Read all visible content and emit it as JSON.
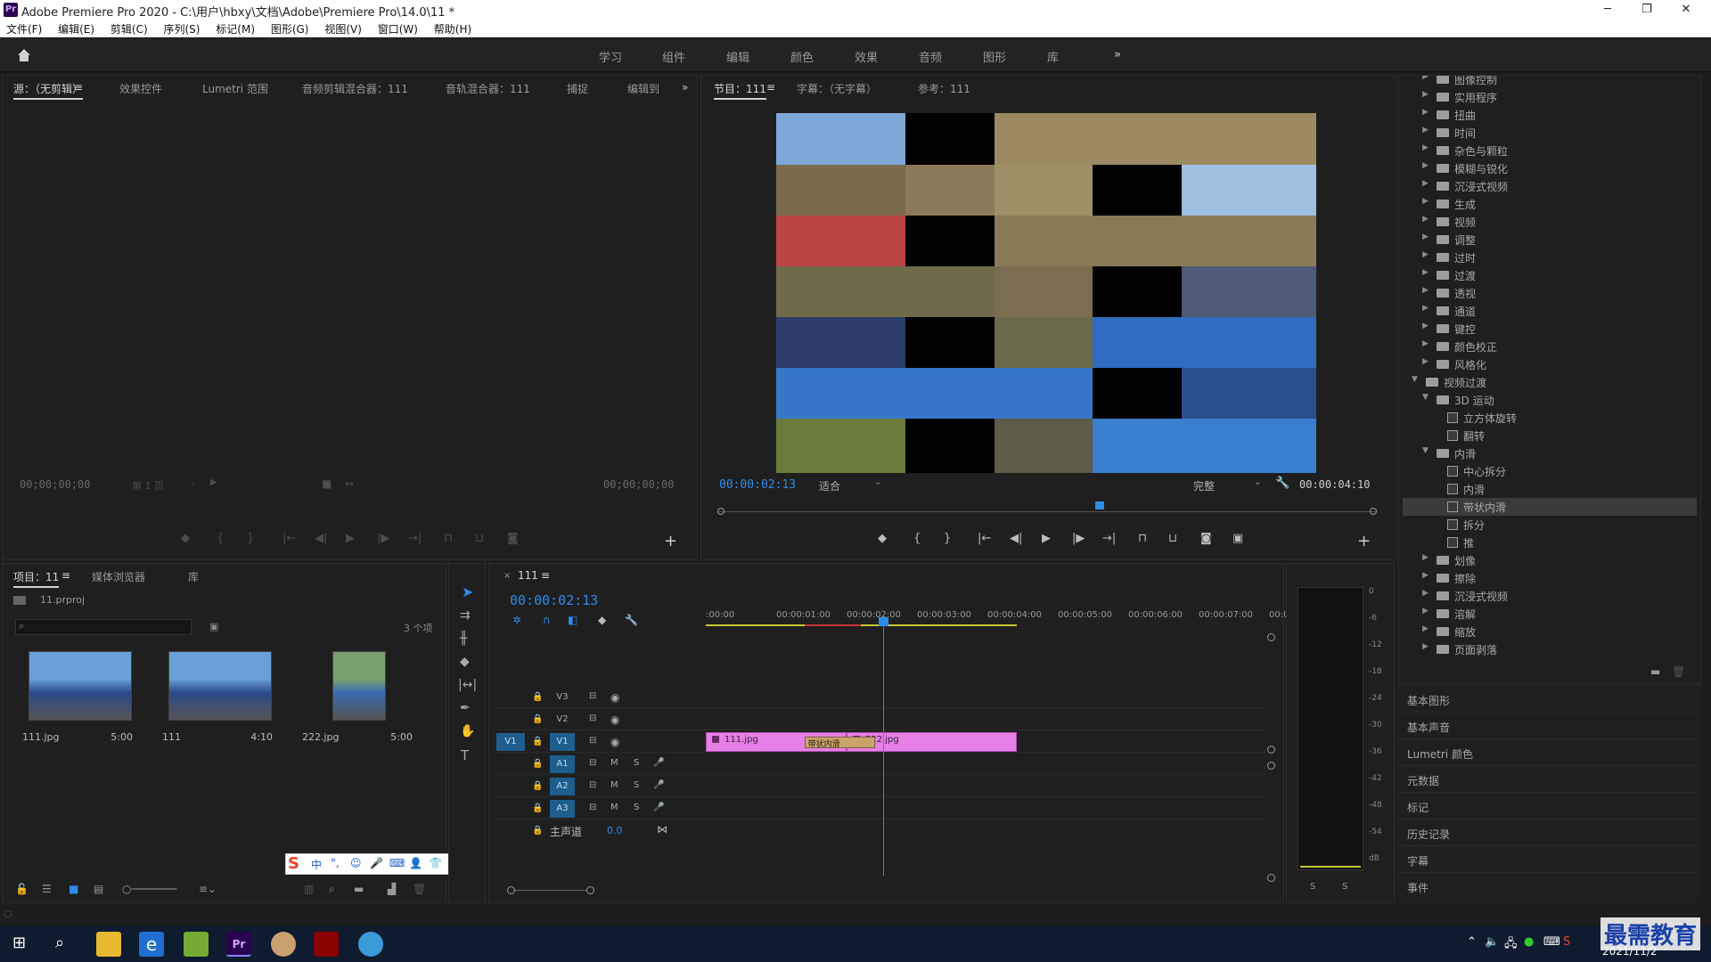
{
  "window": {
    "title": "Adobe Premiere Pro 2020 - C:\\用户\\hbxy\\文档\\Adobe\\Premiere Pro\\14.0\\11 *",
    "logo": "Pr",
    "minimize": "─",
    "maximize": "❐",
    "close": "✕"
  },
  "menu": [
    "文件(F)",
    "编辑(E)",
    "剪辑(C)",
    "序列(S)",
    "标记(M)",
    "图形(G)",
    "视图(V)",
    "窗口(W)",
    "帮助(H)"
  ],
  "workspaces": [
    "学习",
    "组件",
    "编辑",
    "颜色",
    "效果",
    "音频",
    "图形",
    "库"
  ],
  "workspace_more": "»",
  "source_panel": {
    "tabs": [
      "源：（无剪辑）",
      "效果控件",
      "Lumetri 范围",
      "音频剪辑混合器：111",
      "音轨混合器：111",
      "捕捉",
      "编辑到"
    ],
    "more": "»",
    "tc_left": "00;00;00;00",
    "page_select": "第 1 页",
    "tc_right": "00;00;00;00"
  },
  "program_panel": {
    "tabs": [
      "节目：111",
      "字幕：（无字幕）",
      "参考：111"
    ],
    "timecode": "00:00:02:13",
    "fit": "适合",
    "quality": "完整",
    "duration": "00:00:04:10",
    "playhead_fraction": 0.58
  },
  "effects_tree": [
    {
      "label": "图像控制",
      "type": "folder",
      "level": 1,
      "open": false
    },
    {
      "label": "实用程序",
      "type": "folder",
      "level": 1,
      "open": false
    },
    {
      "label": "扭曲",
      "type": "folder",
      "level": 1,
      "open": false
    },
    {
      "label": "时间",
      "type": "folder",
      "level": 1,
      "open": false
    },
    {
      "label": "杂色与颗粒",
      "type": "folder",
      "level": 1,
      "open": false
    },
    {
      "label": "模糊与锐化",
      "type": "folder",
      "level": 1,
      "open": false
    },
    {
      "label": "沉浸式视频",
      "type": "folder",
      "level": 1,
      "open": false
    },
    {
      "label": "生成",
      "type": "folder",
      "level": 1,
      "open": false
    },
    {
      "label": "视频",
      "type": "folder",
      "level": 1,
      "open": false
    },
    {
      "label": "调整",
      "type": "folder",
      "level": 1,
      "open": false
    },
    {
      "label": "过时",
      "type": "folder",
      "level": 1,
      "open": false
    },
    {
      "label": "过渡",
      "type": "folder",
      "level": 1,
      "open": false
    },
    {
      "label": "透视",
      "type": "folder",
      "level": 1,
      "open": false
    },
    {
      "label": "通道",
      "type": "folder",
      "level": 1,
      "open": false
    },
    {
      "label": "键控",
      "type": "folder",
      "level": 1,
      "open": false
    },
    {
      "label": "颜色校正",
      "type": "folder",
      "level": 1,
      "open": false
    },
    {
      "label": "风格化",
      "type": "folder",
      "level": 1,
      "open": false
    },
    {
      "label": "视频过渡",
      "type": "folder",
      "level": 0,
      "open": true
    },
    {
      "label": "3D 运动",
      "type": "folder",
      "level": 1,
      "open": true
    },
    {
      "label": "立方体旋转",
      "type": "effect",
      "level": 2
    },
    {
      "label": "翻转",
      "type": "effect",
      "level": 2
    },
    {
      "label": "内滑",
      "type": "folder",
      "level": 1,
      "open": true
    },
    {
      "label": "中心拆分",
      "type": "effect",
      "level": 2
    },
    {
      "label": "内滑",
      "type": "effect",
      "level": 2
    },
    {
      "label": "带状内滑",
      "type": "effect",
      "level": 2,
      "selected": true
    },
    {
      "label": "拆分",
      "type": "effect",
      "level": 2
    },
    {
      "label": "推",
      "type": "effect",
      "level": 2
    },
    {
      "label": "划像",
      "type": "folder",
      "level": 1,
      "open": false
    },
    {
      "label": "擦除",
      "type": "folder",
      "level": 1,
      "open": false
    },
    {
      "label": "沉浸式视频",
      "type": "folder",
      "level": 1,
      "open": false
    },
    {
      "label": "溶解",
      "type": "folder",
      "level": 1,
      "open": false
    },
    {
      "label": "缩放",
      "type": "folder",
      "level": 1,
      "open": false
    },
    {
      "label": "页面剥落",
      "type": "folder",
      "level": 1,
      "open": false
    }
  ],
  "right_panels": [
    "基本图形",
    "基本声音",
    "Lumetri 颜色",
    "元数据",
    "标记",
    "历史记录",
    "字幕",
    "事件"
  ],
  "project_panel": {
    "tabs": [
      "项目：11",
      "媒体浏览器",
      "库"
    ],
    "file": "11.prproj",
    "count": "3 个项",
    "items": [
      {
        "name": "111.jpg",
        "duration": "5:00"
      },
      {
        "name": "111",
        "duration": "4:10"
      },
      {
        "name": "222.jpg",
        "duration": "5:00"
      }
    ]
  },
  "timeline": {
    "sequence": "111",
    "timecode": "00:00:02:13",
    "ruler": [
      ":00:00",
      "00:00:01:00",
      "00:00:02:00",
      "00:00:03:00",
      "00:00:04:00",
      "00:00:05:00",
      "00:00:06:00",
      "00:00:07:00",
      "00:0("
    ],
    "video_tracks": [
      "V3",
      "V2",
      "V1"
    ],
    "audio_tracks": [
      "A1",
      "A2",
      "A3"
    ],
    "source_v": "V1",
    "master": "主声道",
    "master_value": "0.0",
    "clips": [
      {
        "name": "111.jpg",
        "start": 0.0,
        "end": 2.0
      },
      {
        "name": "222.jpg",
        "start": 2.0,
        "end": 4.42
      }
    ],
    "transition": "带状内滑",
    "mute_label": "M",
    "solo_label": "S"
  },
  "meter": {
    "labels": [
      "0",
      "-6",
      "-12",
      "-18",
      "-24",
      "-30",
      "-36",
      "-42",
      "-48",
      "-54",
      "dB"
    ],
    "solo": [
      "S",
      "S"
    ]
  },
  "ime_bar": [
    "中",
    "°,",
    "☺",
    "🎤",
    "⌨",
    "👤",
    "👕",
    "▦"
  ],
  "watermark": "最需教育",
  "taskbar": {
    "date": "2021/11/2"
  },
  "colors": {
    "accent": "#2d8ceb",
    "clip": "#e67fe6",
    "transition": "#c9a36b",
    "background": "#1d1d1d"
  }
}
